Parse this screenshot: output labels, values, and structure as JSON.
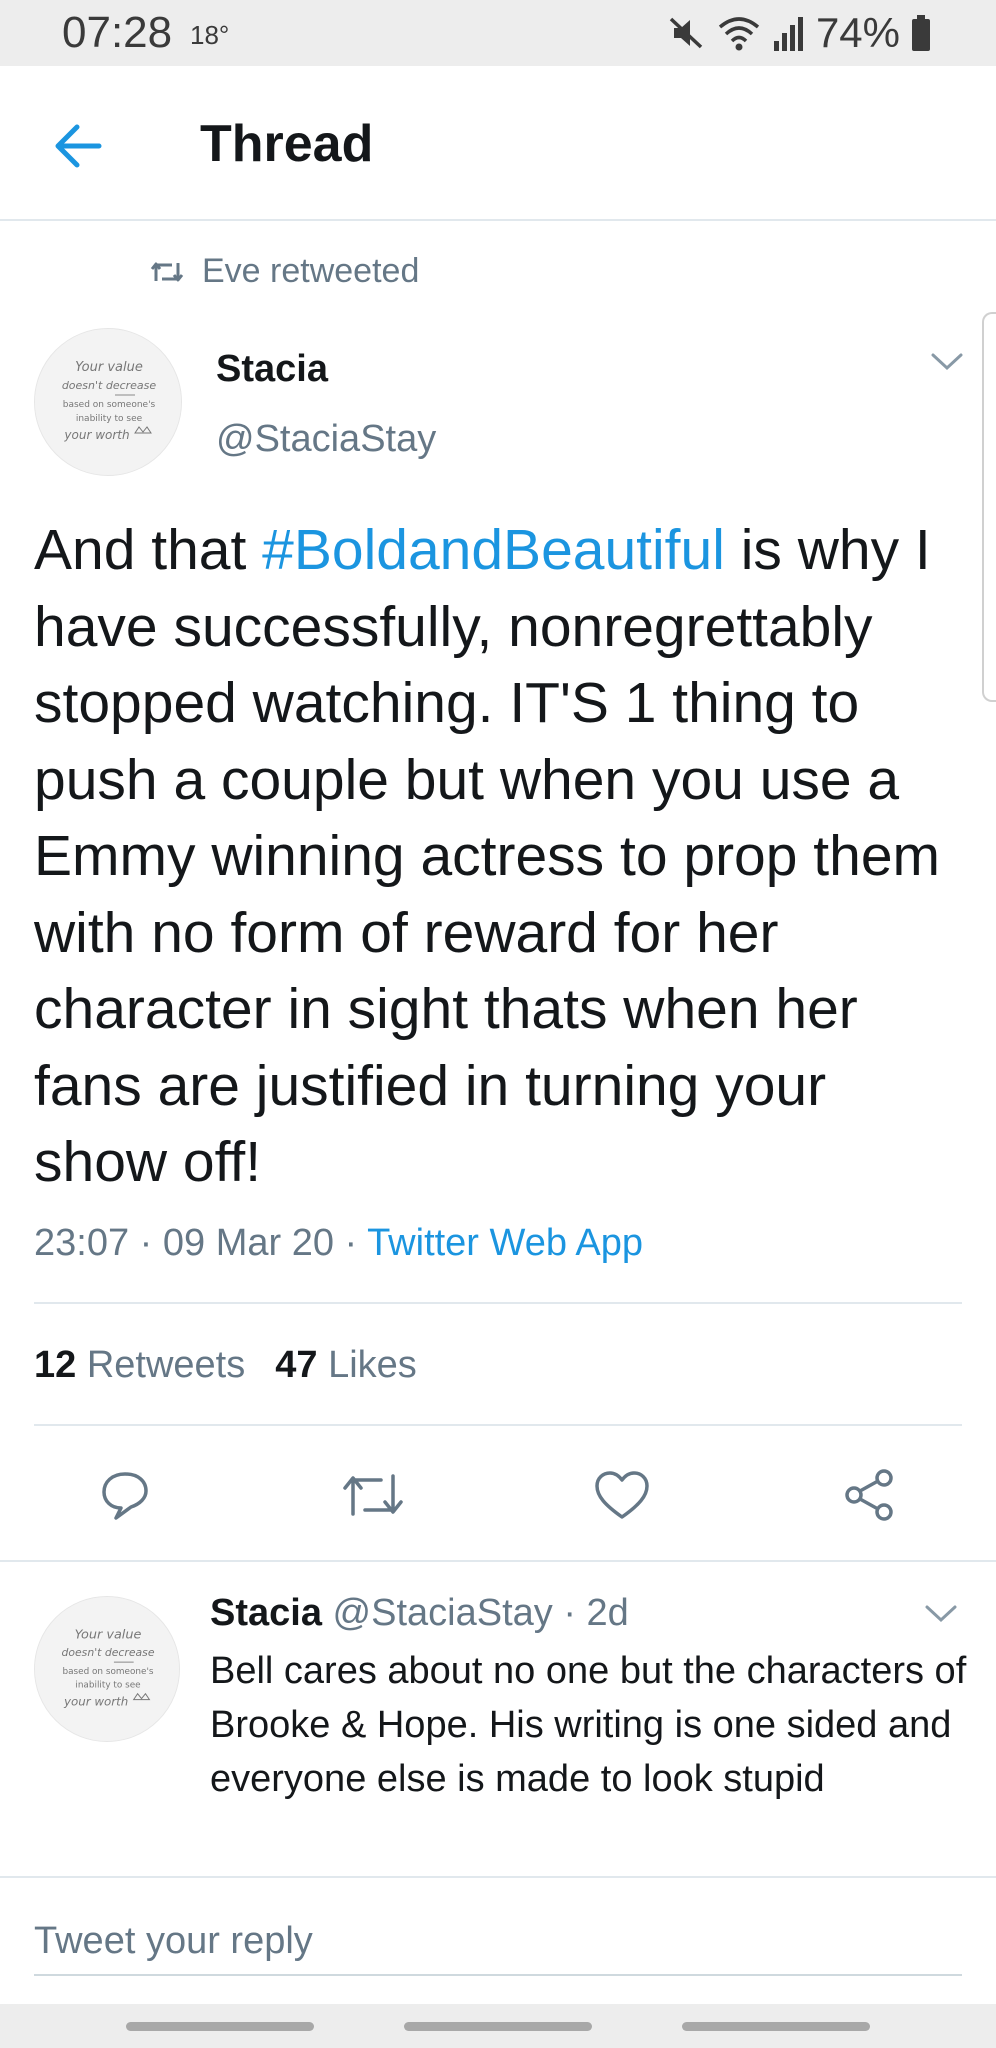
{
  "status_bar": {
    "time": "07:28",
    "temperature": "18°",
    "battery": "74%",
    "icons": [
      "mute-icon",
      "wifi-icon",
      "signal-icon",
      "battery-icon"
    ]
  },
  "header": {
    "title": "Thread",
    "back_icon": "back-arrow-icon"
  },
  "retweet_context": {
    "label": "Eve retweeted",
    "icon": "retweet-icon"
  },
  "tweet": {
    "author_name": "Stacia",
    "author_handle": "@StaciaStay",
    "text_before": "And that ",
    "hashtag": "#BoldandBeautiful",
    "text_after": " is why I have successfully, nonregrettably stopped watching. IT'S 1 thing to push a couple but when you use a Emmy winning actress to prop them with no form of reward for her character in sight thats when her fans are justified in turning your show off!",
    "time": "23:07",
    "date": "09 Mar 20",
    "source": "Twitter Web App",
    "separator": " · ",
    "retweets_count": "12",
    "retweets_label": " Retweets",
    "likes_count": "47",
    "likes_label": " Likes",
    "avatar_lines": [
      "Your value",
      "doesn't decrease",
      "based on someone's",
      "inability to see",
      "your worth"
    ]
  },
  "actions": [
    "reply-icon",
    "retweet-icon",
    "like-icon",
    "share-icon"
  ],
  "reply": {
    "author_name": "Stacia",
    "author_handle": "@StaciaStay",
    "age": "2d",
    "text": "Bell cares about no one but the characters of Brooke & Hope. His writing is one sided and everyone else is made to look stupid"
  },
  "compose": {
    "placeholder": "Tweet your reply"
  },
  "colors": {
    "accent": "#1b95e0",
    "secondary_text": "#657786",
    "divider": "#e1e8ed"
  }
}
